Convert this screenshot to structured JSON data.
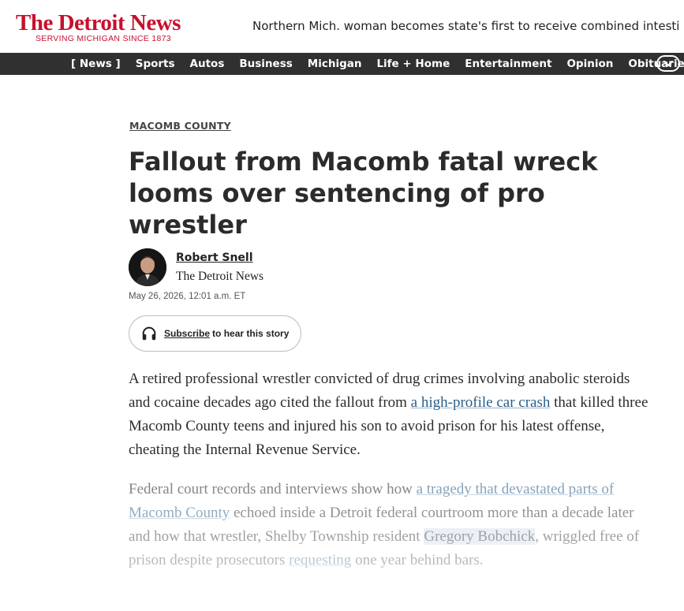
{
  "masthead": {
    "logo_title": "The Detroit News",
    "logo_tagline": "SERVING MICHIGAN SINCE 1873",
    "ticker_text": "Northern Mich. woman becomes state's first to receive combined intesti"
  },
  "nav": {
    "items": [
      {
        "label": "News",
        "active": true
      },
      {
        "label": "Sports"
      },
      {
        "label": "Autos"
      },
      {
        "label": "Business"
      },
      {
        "label": "Michigan"
      },
      {
        "label": "Life + Home"
      },
      {
        "label": "Entertainment"
      },
      {
        "label": "Opinion"
      },
      {
        "label": "Obituaries"
      }
    ],
    "toggle_icon": "chevron-down-icon",
    "bracket_open": "[",
    "bracket_close": "]"
  },
  "article": {
    "section": "MACOMB COUNTY",
    "headline": "Fallout from Macomb fatal wreck looms over sentencing of pro wrestler",
    "author_name": "Robert Snell",
    "author_org": "The Detroit News",
    "dateline": "May 26, 2026, 12:01 a.m. ET",
    "subscribe_link": "Subscribe",
    "subscribe_rest": "to hear this story",
    "p1_a": "A retired professional wrestler convicted of drug crimes involving anabolic steroids and cocaine decades ago cited the fallout from ",
    "p1_link": "a high-profile car crash",
    "p1_b": " that killed three Macomb County teens and injured his son to avoid prison for his latest offense, cheating the Internal Revenue Service.",
    "p2_a": "Federal court records and interviews show how ",
    "p2_link1": "a tragedy that devastated parts of Macomb County",
    "p2_b": " echoed inside a Detroit federal courtroom more than a decade later and how that wrestler, Shelby Township resident ",
    "p2_highlight": "Gregory Bobchick",
    "p2_c": ", wriggled free of prison despite prosecutors ",
    "p2_link2": "requesting",
    "p2_d": " one year behind bars."
  },
  "colors": {
    "brand": "#c8102e",
    "nav_bg": "#303030",
    "link": "#2a5e87"
  }
}
